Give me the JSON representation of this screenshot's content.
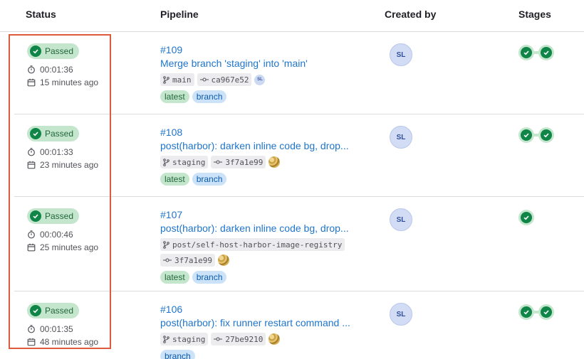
{
  "table": {
    "headers": {
      "status": "Status",
      "pipeline": "Pipeline",
      "created_by": "Created by",
      "stages": "Stages"
    },
    "rows": [
      {
        "status": "Passed",
        "duration": "00:01:36",
        "finished": "15 minutes ago",
        "id": "#109",
        "title": "Merge branch 'staging' into 'main'",
        "branch": "main",
        "commit": "ca967e52",
        "commit_avatar": "SL",
        "labels": [
          "latest",
          "branch"
        ],
        "author": "SL",
        "stages": 2
      },
      {
        "status": "Passed",
        "duration": "00:01:33",
        "finished": "23 minutes ago",
        "id": "#108",
        "title": "post(harbor): darken inline code bg, drop...",
        "branch": "staging",
        "commit": "3f7a1e99",
        "commit_avatar": "",
        "labels": [
          "latest",
          "branch"
        ],
        "author": "SL",
        "stages": 2
      },
      {
        "status": "Passed",
        "duration": "00:00:46",
        "finished": "25 minutes ago",
        "id": "#107",
        "title": "post(harbor): darken inline code bg, drop...",
        "branch": "post/self-host-harbor-image-registry",
        "commit": "3f7a1e99",
        "commit_avatar": "",
        "labels": [
          "latest",
          "branch"
        ],
        "author": "SL",
        "stages": 1
      },
      {
        "status": "Passed",
        "duration": "00:01:35",
        "finished": "48 minutes ago",
        "id": "#106",
        "title": "post(harbor): fix runner restart command ...",
        "branch": "staging",
        "commit": "27be9210",
        "commit_avatar": "",
        "labels": [
          "branch"
        ],
        "author": "SL",
        "stages": 2
      }
    ]
  },
  "icons": {
    "status": "check-circle-icon",
    "duration": "timer-icon",
    "finished": "calendar-icon",
    "branch": "branch-icon",
    "commit": "commit-icon",
    "stage": "stage-passed-icon"
  },
  "colors": {
    "success": "#108548",
    "link": "#1f75cb",
    "highlight": "#dd5a3a"
  }
}
